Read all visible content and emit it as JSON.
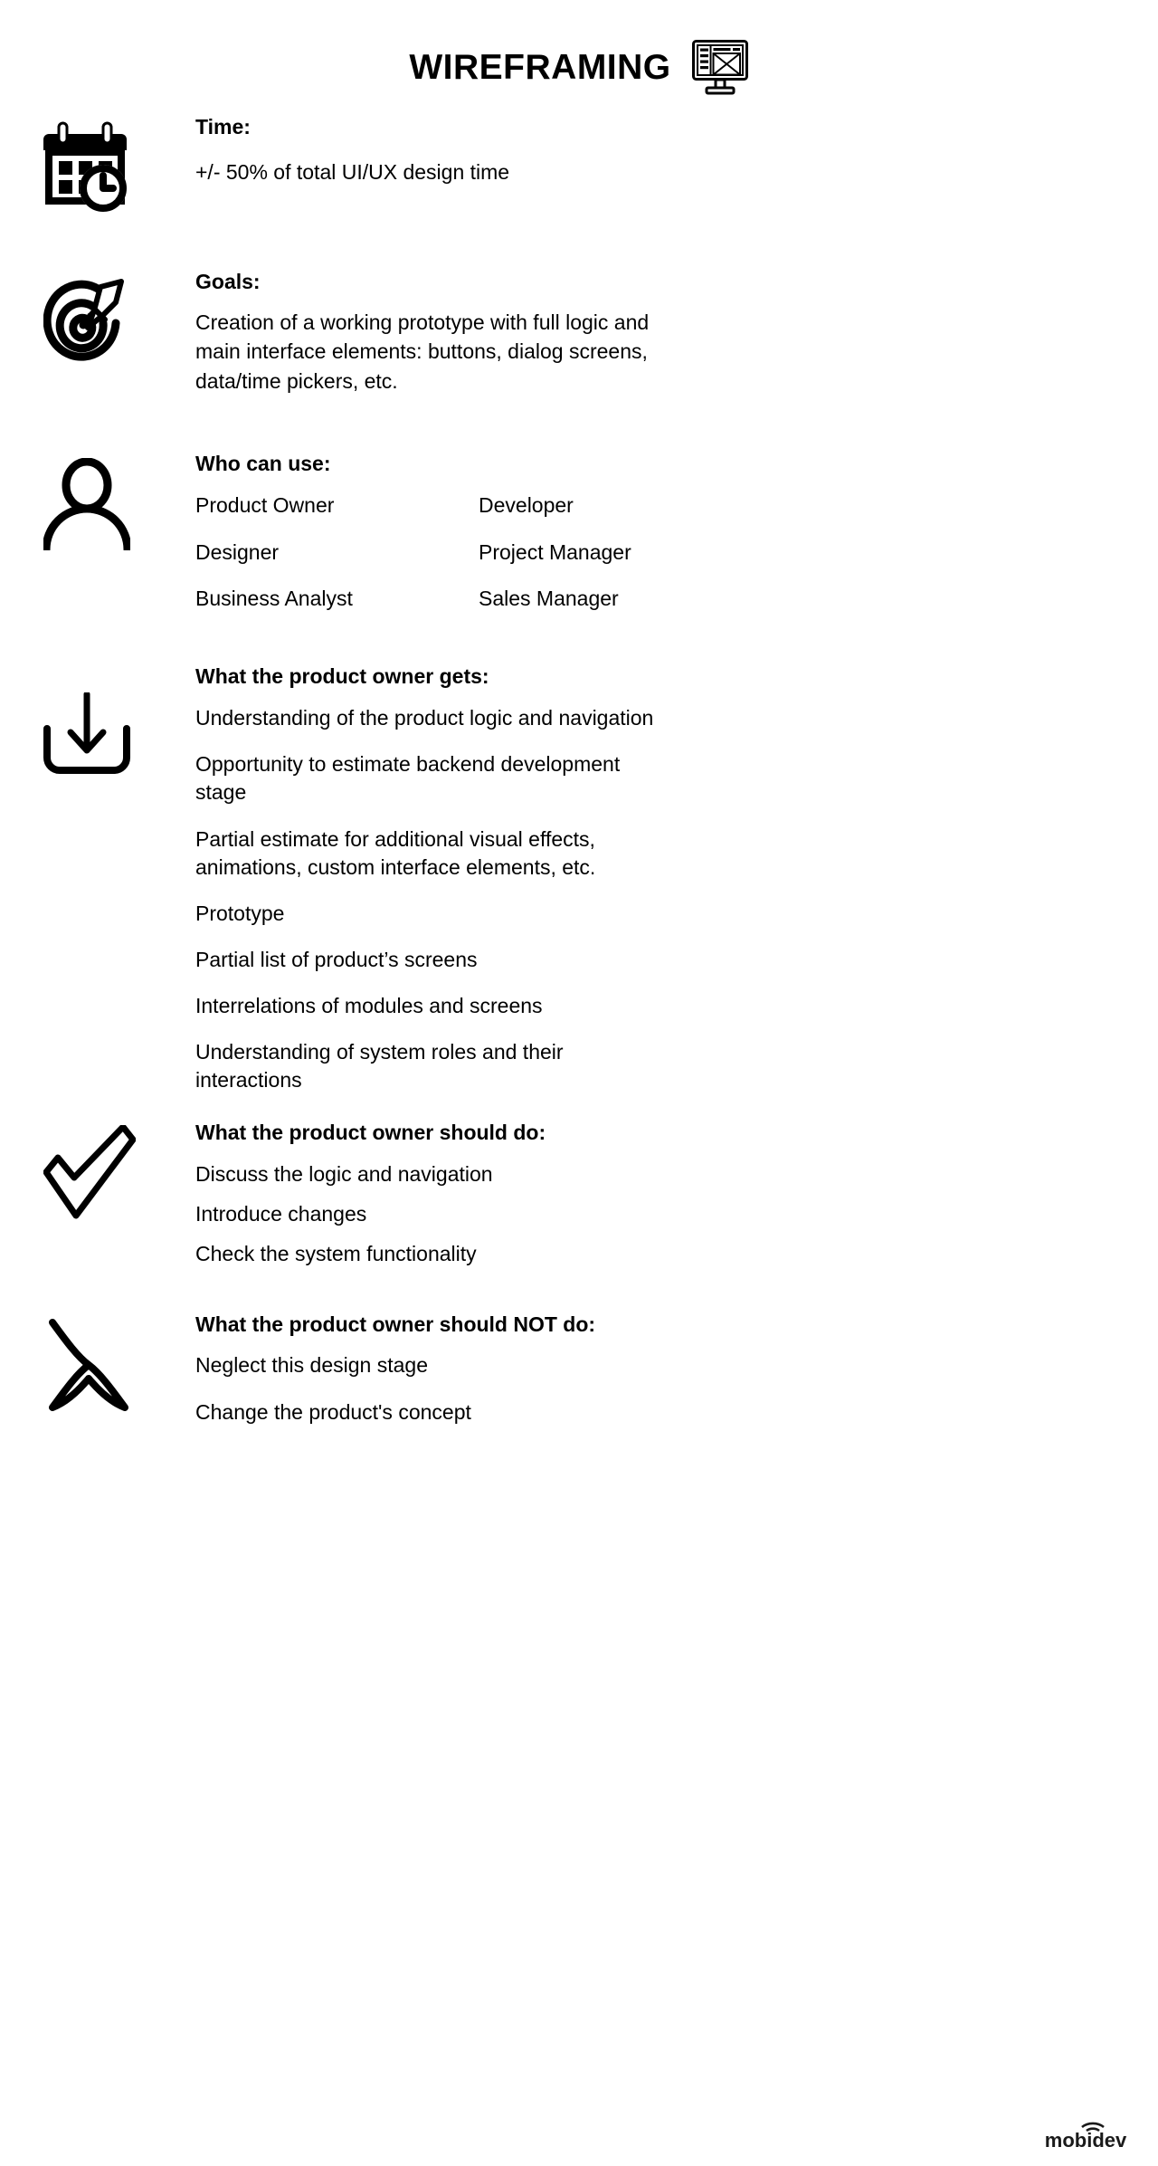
{
  "title": {
    "text": "WIREFRAMING",
    "icon": "wireframe-monitor-icon"
  },
  "sections": [
    {
      "id": "time",
      "icon": "calendar-clock-icon",
      "heading": "Time:",
      "paragraph": "+/- 50% of total UI/UX design time"
    },
    {
      "id": "goals",
      "icon": "target-pencil-icon",
      "heading": "Goals:",
      "paragraph": "Creation of a working prototype with full logic and main interface elements: buttons, dialog screens, data/time pickers, etc."
    },
    {
      "id": "who-can-use",
      "icon": "person-icon",
      "heading": "Who can use:",
      "roles_left": [
        "Product Owner",
        "Designer",
        "Business Analyst"
      ],
      "roles_right": [
        "Developer",
        "Project Manager",
        "Sales Manager"
      ]
    },
    {
      "id": "product-owner-gets",
      "icon": "download-arrow-icon",
      "heading": "What the product owner gets:",
      "items": [
        "Understanding of the product logic and navigation",
        "Opportunity to estimate backend development stage",
        "Partial estimate for additional visual effects, animations, custom interface elements, etc.",
        "Prototype",
        "Partial list of product’s screens",
        "Interrelations of modules and screens",
        "Understanding of system roles and their interactions"
      ]
    },
    {
      "id": "product-owner-should-do",
      "icon": "checkmark-icon",
      "heading": "What the product owner should do:",
      "items": [
        "Discuss the logic and navigation",
        "Introduce changes",
        "Check the system functionality"
      ]
    },
    {
      "id": "product-owner-should-not-do",
      "icon": "cross-x-icon",
      "heading": "What the product owner should NOT do:",
      "items": [
        "Neglect this design stage",
        "Change the product's concept"
      ]
    }
  ],
  "footer": {
    "logo_text": "mobidev",
    "logo_icon": "signal-arc-icon"
  },
  "colors": {
    "ink": "#000000",
    "background": "#ffffff"
  }
}
